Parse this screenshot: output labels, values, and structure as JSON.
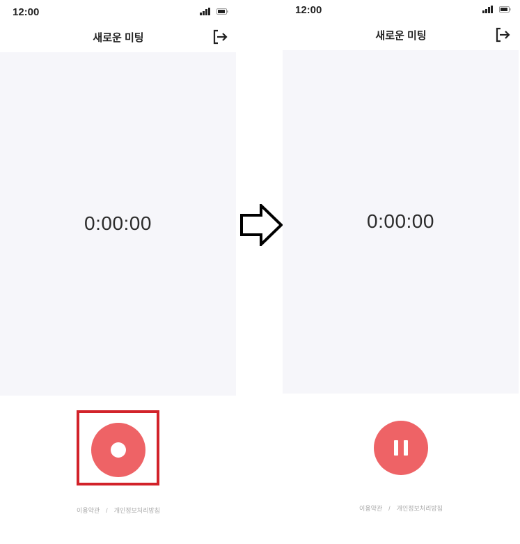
{
  "screens": [
    {
      "status_time": "12:00",
      "title": "새로운 미팅",
      "timer": "0:00:00",
      "action_button": "record-icon",
      "footer": {
        "terms": "이용약관",
        "separator": "/",
        "privacy": "개인정보처리방침"
      }
    },
    {
      "status_time": "12:00",
      "title": "새로운 미팅",
      "timer": "0:00:00",
      "action_button": "pause-icon",
      "footer": {
        "terms": "이용약관",
        "separator": "/",
        "privacy": "개인정보처리방침"
      }
    }
  ],
  "icons": {
    "exit": "exit-icon",
    "signal": "signal-icon",
    "battery": "battery-icon",
    "transition": "arrow-right-icon"
  },
  "colors": {
    "accent": "#ee6366",
    "highlight": "#d2232a",
    "panel_background": "#f6f6fa",
    "text": "#222222",
    "footer_text": "#aaaaaa"
  }
}
